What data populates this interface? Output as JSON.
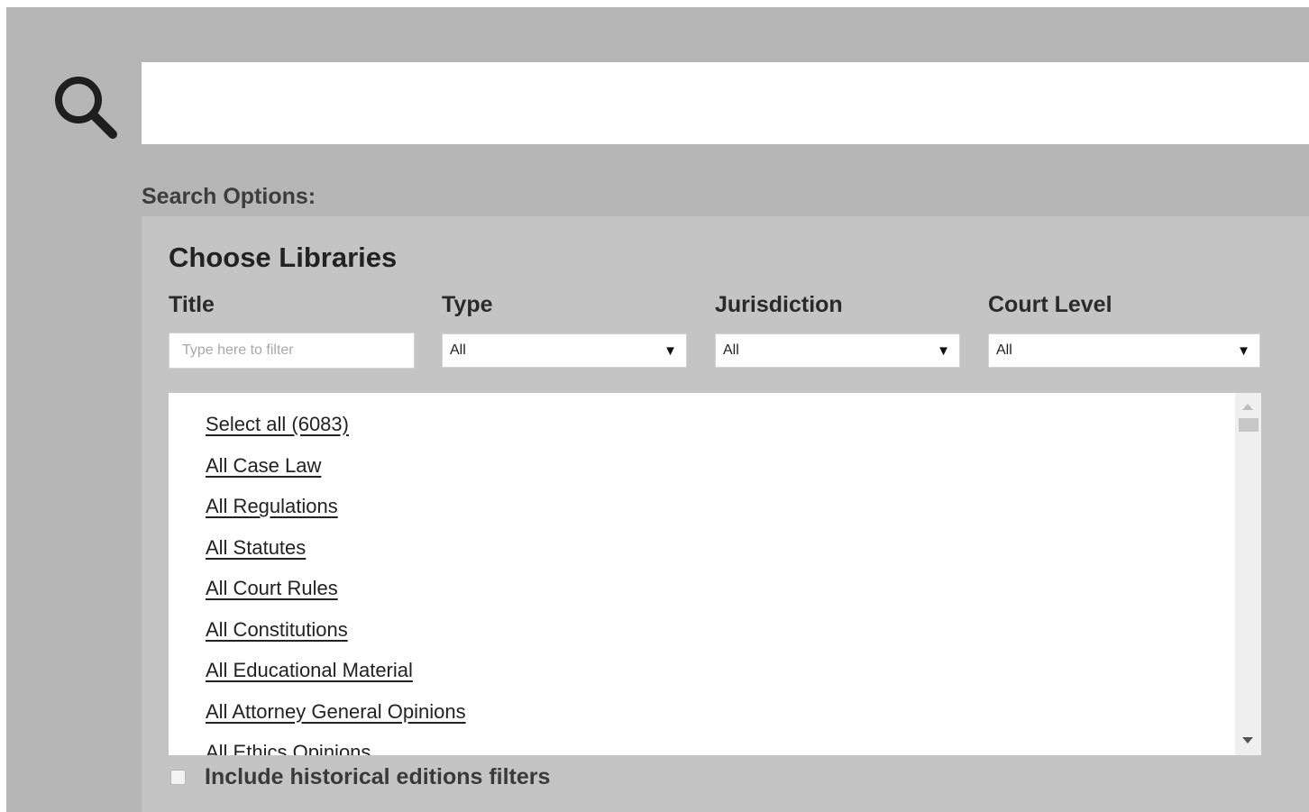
{
  "search": {
    "value": "",
    "icon": "search-icon"
  },
  "search_options": {
    "label": "Search Options:"
  },
  "libraries": {
    "heading": "Choose Libraries",
    "filters": {
      "title": {
        "label": "Title",
        "placeholder": "Type here to filter",
        "value": ""
      },
      "type": {
        "label": "Type",
        "value": "All"
      },
      "jurisdiction": {
        "label": "Jurisdiction",
        "value": "All"
      },
      "court_level": {
        "label": "Court Level",
        "value": "All"
      }
    },
    "items": [
      "Select all (6083)",
      "All Case Law",
      "All Regulations",
      "All Statutes",
      "All Court Rules",
      "All Constitutions",
      "All Educational Material",
      "All Attorney General Opinions",
      "All Ethics Opinions"
    ]
  },
  "historical": {
    "label": "Include historical editions filters",
    "checked": false
  },
  "colors": {
    "app_background": "#b6b6b6",
    "panel_background": "#c4c4c4",
    "input_background": "#ffffff"
  }
}
